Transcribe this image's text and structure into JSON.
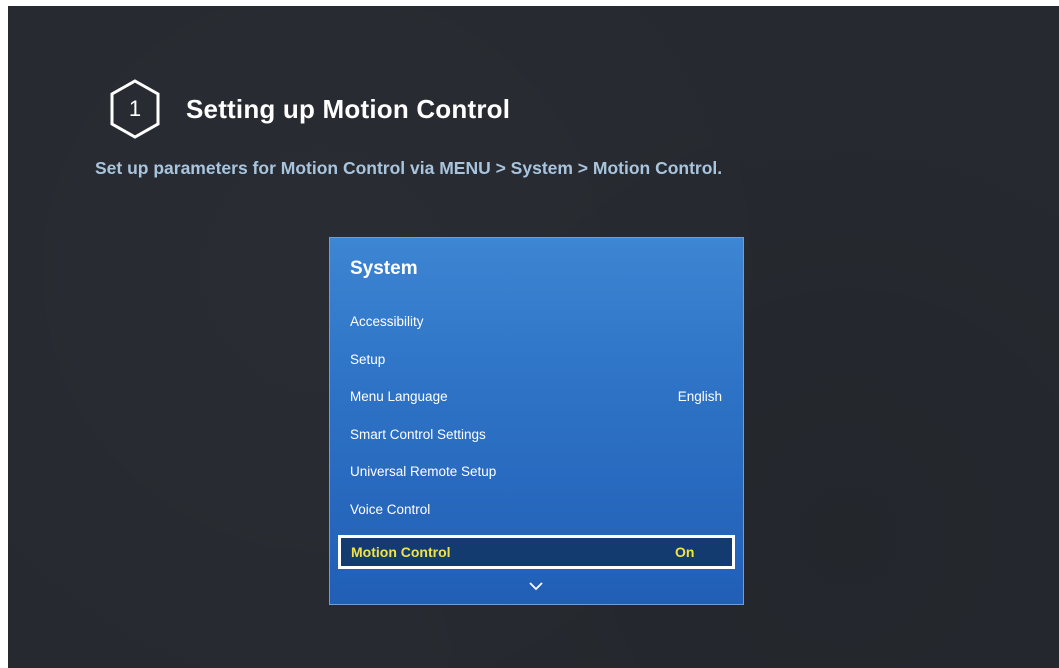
{
  "header": {
    "step_number": "1",
    "title": "Setting up Motion Control",
    "subtitle": "Set up parameters for Motion Control via MENU > System > Motion Control."
  },
  "menu": {
    "title": "System",
    "items": [
      {
        "label": "Accessibility",
        "value": ""
      },
      {
        "label": "Setup",
        "value": ""
      },
      {
        "label": "Menu Language",
        "value": "English"
      },
      {
        "label": "Smart Control Settings",
        "value": ""
      },
      {
        "label": "Universal Remote Setup",
        "value": ""
      },
      {
        "label": "Voice Control",
        "value": ""
      }
    ],
    "selected": {
      "label": "Motion Control",
      "value": "On"
    },
    "scroll_icon": "chevron-down-icon"
  },
  "colors": {
    "background": "#262a30",
    "panel": "#2e73c6",
    "highlight_text": "#f2e24a",
    "subtitle_text": "#a9c4dd"
  }
}
